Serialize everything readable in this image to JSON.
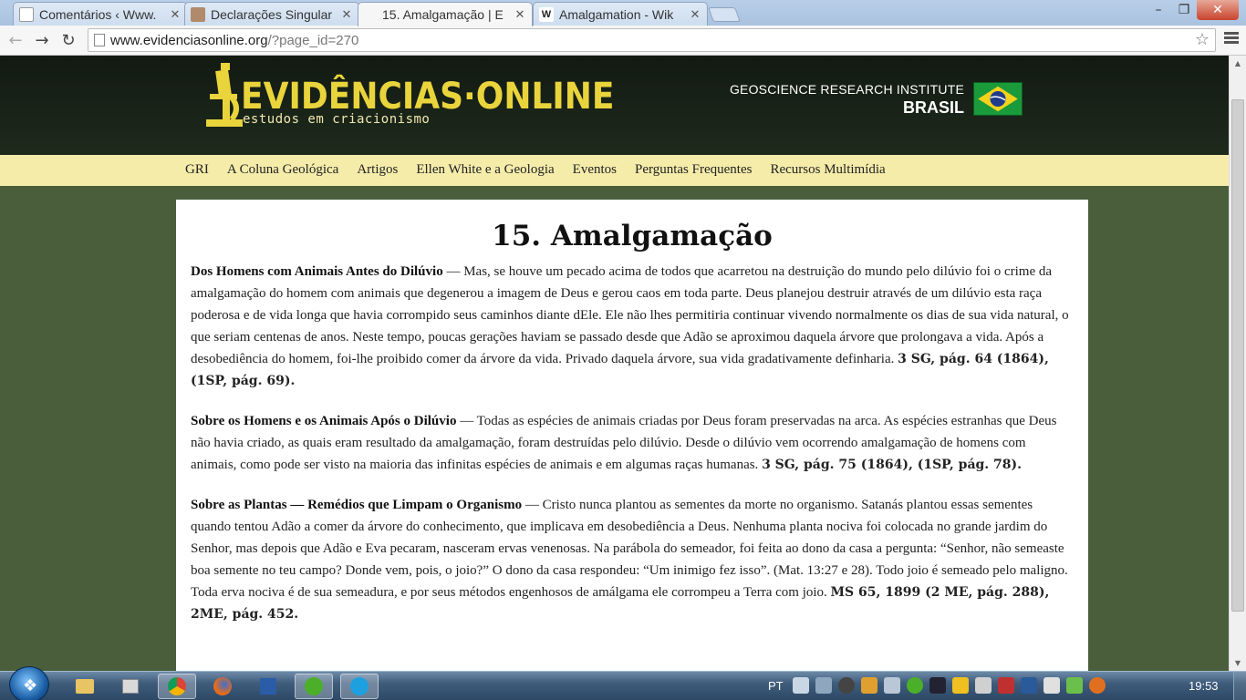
{
  "browser": {
    "tabs": [
      {
        "title": "Comentários ‹ Www.",
        "favicon": "doc",
        "active": false
      },
      {
        "title": "Declarações Singular",
        "favicon": "avatar",
        "active": false
      },
      {
        "title": "15. Amalgamação | E",
        "favicon": "doc",
        "active": true
      },
      {
        "title": "Amalgamation - Wik",
        "favicon": "W",
        "active": false
      }
    ],
    "url_host": "www.evidenciasonline.org",
    "url_path": "/?page_id=270",
    "window_buttons": {
      "minimize": "–",
      "maximize": "❐",
      "close": "✕"
    }
  },
  "site": {
    "logo_title": "EVIDÊNCIAS·ONLINE",
    "logo_subtitle": "estudos em criacionismo",
    "institute_line1": "GEOSCIENCE RESEARCH INSTITUTE",
    "institute_line2": "BRASIL",
    "nav": [
      "GRI",
      "A Coluna Geológica",
      "Artigos",
      "Ellen White e a Geologia",
      "Eventos",
      "Perguntas Frequentes",
      "Recursos Multimídia"
    ]
  },
  "article": {
    "title": "15. Amalgamação",
    "paragraphs": [
      {
        "heading": "Dos Homens com Animais Antes do Dilúvio",
        "text": " — Mas, se houve um pecado acima de todos que acarretou na destruição do mundo pelo dilúvio foi o crime da amalgamação do homem com animais que degenerou a imagem de Deus e gerou caos em toda parte. Deus planejou destruir através de um dilúvio esta raça poderosa e de vida longa que havia corrompido seus caminhos diante dEle. Ele não lhes permitiria continuar vivendo normalmente os dias de sua vida natural, o que seriam centenas de anos. Neste tempo, poucas gerações haviam se passado desde que Adão se aproximou daquela árvore que prolongava a vida. Após a desobediência do homem, foi-lhe proibido comer da árvore da vida. Privado daquela árvore, sua vida gradativamente definharia. ",
        "ref": "3 SG, pág. 64 (1864), (1SP, pág. 69)."
      },
      {
        "heading": "Sobre os Homens e os Animais Após o Dilúvio",
        "text": " — Todas as espécies de animais criadas por Deus foram preservadas na arca. As espécies estranhas que Deus não havia criado, as quais eram resultado da amalgamação, foram destruídas pelo dilúvio. Desde o dilúvio vem ocorrendo amalgamação de homens com animais, como pode ser visto na maioria das infinitas espécies de animais e em algumas raças humanas. ",
        "ref": "3 SG, pág. 75 (1864), (1SP, pág. 78)."
      },
      {
        "heading": "Sobre as Plantas — Remédios que Limpam o Organismo",
        "text": " — Cristo nunca plantou as sementes da morte no organismo. Satanás plantou essas sementes quando tentou Adão a comer da árvore do conhecimento, que implicava em desobediência a Deus. Nenhuma planta nociva foi colocada no grande jardim do Senhor, mas depois que Adão e Eva pecaram, nasceram ervas venenosas. Na parábola do semeador, foi feita ao dono da casa a pergunta: “Senhor, não semeaste boa semente no teu campo? Donde vem, pois, o joio?” O dono da casa respondeu: “Um inimigo fez isso”. (Mat. 13:27 e 28). Todo joio é semeado pelo maligno. Toda erva nociva é de sua semeadura, e por seus métodos engenhosos de amálgama ele corrompeu a Terra com joio. ",
        "ref": "MS 65, 1899 (2 ME, pág. 288), 2ME, pág. 452."
      }
    ]
  },
  "taskbar": {
    "language": "PT",
    "clock": "19:53",
    "apps": [
      "explorer",
      "media-player",
      "chrome",
      "firefox",
      "word",
      "utorrent",
      "skype"
    ]
  },
  "colors": {
    "header_bg": "#16201a",
    "nav_bg": "#f5ecaa",
    "page_bg": "#4a5e3c",
    "logo_yellow": "#e9d43c"
  }
}
